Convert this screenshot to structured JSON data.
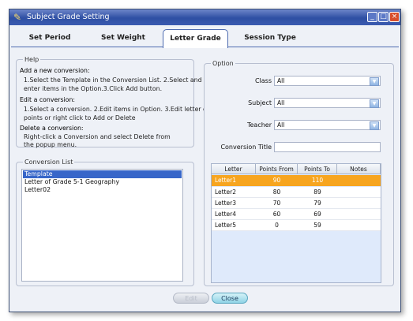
{
  "window": {
    "title": "Subject Grade Setting",
    "icon": "app-icon",
    "controls": [
      "_",
      "□",
      "×"
    ]
  },
  "tabs": [
    {
      "label": "Set Period"
    },
    {
      "label": "Set Weight"
    },
    {
      "label": "Letter Grade",
      "active": true
    },
    {
      "label": "Session Type"
    }
  ],
  "help": {
    "legend": "Help",
    "lines": [
      "Add a new conversion:",
      "1.Select the Template in the Conversion List. 2.Select and",
      "enter items in the Option.3.Click Add button.",
      "Edit a conversion:",
      "1.Select a conversion. 2.Edit items in Option. 3.Edit letter or",
      "points or right click to Add or Delete",
      "Delete a conversion:",
      "Right-click a Conversion and select Delete from",
      "the popup menu."
    ]
  },
  "conversion_list": {
    "legend": "Conversion List",
    "items": [
      "Template",
      "Letter of Grade 5-1 Geography",
      "Letter02"
    ],
    "selected_index": 0
  },
  "option": {
    "legend": "Option",
    "class_label": "Class",
    "class_value": "All",
    "subject_label": "Subject",
    "subject_value": "All",
    "teacher_label": "Teacher",
    "teacher_value": "All",
    "title_label": "Conversion Title",
    "title_value": ""
  },
  "grid": {
    "headers": [
      "Letter",
      "Points From",
      "Points To",
      "Notes"
    ],
    "rows": [
      [
        "Letter1",
        "90",
        "110",
        ""
      ],
      [
        "Letter2",
        "80",
        "89",
        ""
      ],
      [
        "Letter3",
        "70",
        "79",
        ""
      ],
      [
        "Letter4",
        "60",
        "69",
        ""
      ],
      [
        "Letter5",
        "0",
        "59",
        ""
      ]
    ],
    "selected_row": 0
  },
  "buttons": {
    "edit": "Edit",
    "close": "Close"
  },
  "colors": {
    "accent": "#3b5bb0",
    "selection": "#f7a51f",
    "list_selection": "#3766c9"
  }
}
